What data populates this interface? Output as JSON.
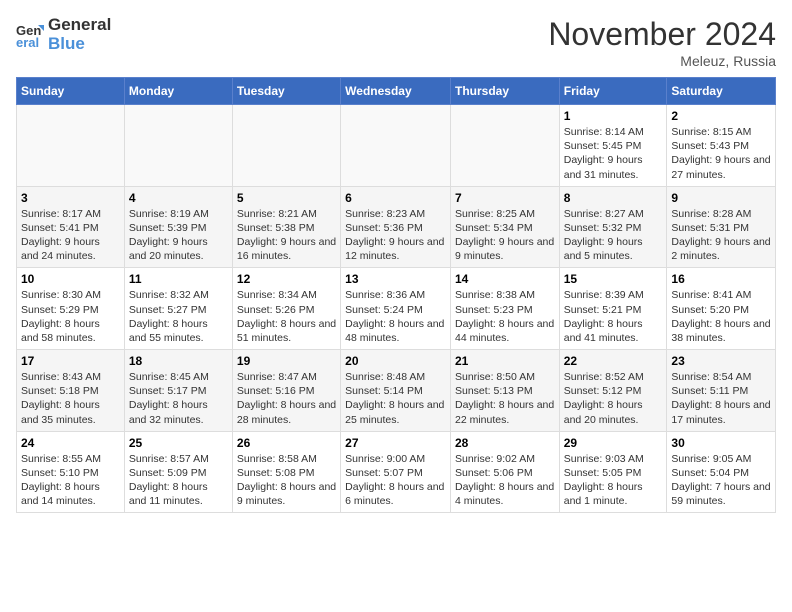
{
  "logo": {
    "line1": "General",
    "line2": "Blue"
  },
  "title": "November 2024",
  "location": "Meleuz, Russia",
  "days": [
    "Sunday",
    "Monday",
    "Tuesday",
    "Wednesday",
    "Thursday",
    "Friday",
    "Saturday"
  ],
  "weeks": [
    [
      {
        "day": "",
        "info": ""
      },
      {
        "day": "",
        "info": ""
      },
      {
        "day": "",
        "info": ""
      },
      {
        "day": "",
        "info": ""
      },
      {
        "day": "",
        "info": ""
      },
      {
        "day": "1",
        "info": "Sunrise: 8:14 AM\nSunset: 5:45 PM\nDaylight: 9 hours and 31 minutes."
      },
      {
        "day": "2",
        "info": "Sunrise: 8:15 AM\nSunset: 5:43 PM\nDaylight: 9 hours and 27 minutes."
      }
    ],
    [
      {
        "day": "3",
        "info": "Sunrise: 8:17 AM\nSunset: 5:41 PM\nDaylight: 9 hours and 24 minutes."
      },
      {
        "day": "4",
        "info": "Sunrise: 8:19 AM\nSunset: 5:39 PM\nDaylight: 9 hours and 20 minutes."
      },
      {
        "day": "5",
        "info": "Sunrise: 8:21 AM\nSunset: 5:38 PM\nDaylight: 9 hours and 16 minutes."
      },
      {
        "day": "6",
        "info": "Sunrise: 8:23 AM\nSunset: 5:36 PM\nDaylight: 9 hours and 12 minutes."
      },
      {
        "day": "7",
        "info": "Sunrise: 8:25 AM\nSunset: 5:34 PM\nDaylight: 9 hours and 9 minutes."
      },
      {
        "day": "8",
        "info": "Sunrise: 8:27 AM\nSunset: 5:32 PM\nDaylight: 9 hours and 5 minutes."
      },
      {
        "day": "9",
        "info": "Sunrise: 8:28 AM\nSunset: 5:31 PM\nDaylight: 9 hours and 2 minutes."
      }
    ],
    [
      {
        "day": "10",
        "info": "Sunrise: 8:30 AM\nSunset: 5:29 PM\nDaylight: 8 hours and 58 minutes."
      },
      {
        "day": "11",
        "info": "Sunrise: 8:32 AM\nSunset: 5:27 PM\nDaylight: 8 hours and 55 minutes."
      },
      {
        "day": "12",
        "info": "Sunrise: 8:34 AM\nSunset: 5:26 PM\nDaylight: 8 hours and 51 minutes."
      },
      {
        "day": "13",
        "info": "Sunrise: 8:36 AM\nSunset: 5:24 PM\nDaylight: 8 hours and 48 minutes."
      },
      {
        "day": "14",
        "info": "Sunrise: 8:38 AM\nSunset: 5:23 PM\nDaylight: 8 hours and 44 minutes."
      },
      {
        "day": "15",
        "info": "Sunrise: 8:39 AM\nSunset: 5:21 PM\nDaylight: 8 hours and 41 minutes."
      },
      {
        "day": "16",
        "info": "Sunrise: 8:41 AM\nSunset: 5:20 PM\nDaylight: 8 hours and 38 minutes."
      }
    ],
    [
      {
        "day": "17",
        "info": "Sunrise: 8:43 AM\nSunset: 5:18 PM\nDaylight: 8 hours and 35 minutes."
      },
      {
        "day": "18",
        "info": "Sunrise: 8:45 AM\nSunset: 5:17 PM\nDaylight: 8 hours and 32 minutes."
      },
      {
        "day": "19",
        "info": "Sunrise: 8:47 AM\nSunset: 5:16 PM\nDaylight: 8 hours and 28 minutes."
      },
      {
        "day": "20",
        "info": "Sunrise: 8:48 AM\nSunset: 5:14 PM\nDaylight: 8 hours and 25 minutes."
      },
      {
        "day": "21",
        "info": "Sunrise: 8:50 AM\nSunset: 5:13 PM\nDaylight: 8 hours and 22 minutes."
      },
      {
        "day": "22",
        "info": "Sunrise: 8:52 AM\nSunset: 5:12 PM\nDaylight: 8 hours and 20 minutes."
      },
      {
        "day": "23",
        "info": "Sunrise: 8:54 AM\nSunset: 5:11 PM\nDaylight: 8 hours and 17 minutes."
      }
    ],
    [
      {
        "day": "24",
        "info": "Sunrise: 8:55 AM\nSunset: 5:10 PM\nDaylight: 8 hours and 14 minutes."
      },
      {
        "day": "25",
        "info": "Sunrise: 8:57 AM\nSunset: 5:09 PM\nDaylight: 8 hours and 11 minutes."
      },
      {
        "day": "26",
        "info": "Sunrise: 8:58 AM\nSunset: 5:08 PM\nDaylight: 8 hours and 9 minutes."
      },
      {
        "day": "27",
        "info": "Sunrise: 9:00 AM\nSunset: 5:07 PM\nDaylight: 8 hours and 6 minutes."
      },
      {
        "day": "28",
        "info": "Sunrise: 9:02 AM\nSunset: 5:06 PM\nDaylight: 8 hours and 4 minutes."
      },
      {
        "day": "29",
        "info": "Sunrise: 9:03 AM\nSunset: 5:05 PM\nDaylight: 8 hours and 1 minute."
      },
      {
        "day": "30",
        "info": "Sunrise: 9:05 AM\nSunset: 5:04 PM\nDaylight: 7 hours and 59 minutes."
      }
    ]
  ]
}
